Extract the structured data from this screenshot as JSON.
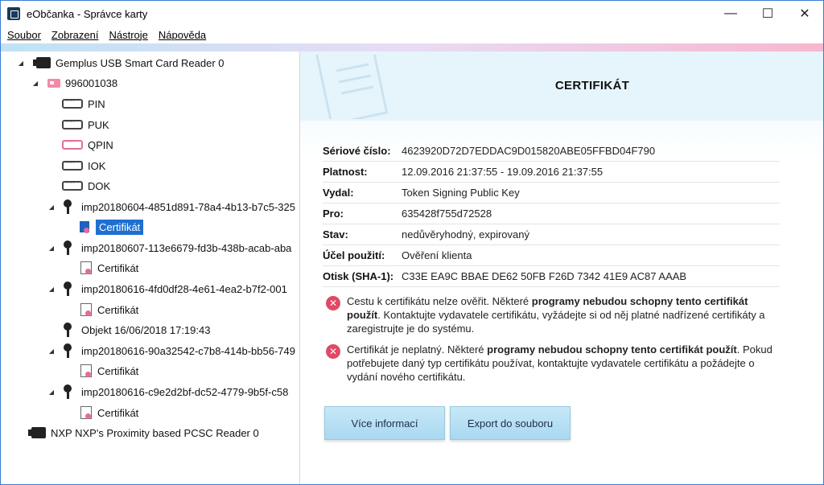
{
  "window": {
    "title": "eObčanka - Správce karty",
    "controls": {
      "minimize": "—",
      "maximize": "☐",
      "close": "✕"
    }
  },
  "menu": [
    "Soubor",
    "Zobrazení",
    "Nástroje",
    "Nápověda"
  ],
  "tree": {
    "reader1": "Gemplus USB Smart Card Reader 0",
    "card": "996001038",
    "pins": [
      "PIN",
      "PUK",
      "QPIN",
      "IOK",
      "DOK"
    ],
    "keys": [
      {
        "label": "imp20180604-4851d891-78a4-4b13-b7c5-325",
        "child": "Certifikát"
      },
      {
        "label": "imp20180607-113e6679-fd3b-438b-acab-aba",
        "child": "Certifikát"
      },
      {
        "label": "imp20180616-4fd0df28-4e61-4ea2-b7f2-001",
        "child": "Certifikát"
      },
      {
        "label": "Objekt 16/06/2018 17:19:43"
      },
      {
        "label": "imp20180616-90a32542-c7b8-414b-bb56-749",
        "child": "Certifikát"
      },
      {
        "label": "imp20180616-c9e2d2bf-dc52-4779-9b5f-c58",
        "child": "Certifikát"
      }
    ],
    "reader2": "NXP NXP's Proximity based PCSC Reader 0"
  },
  "detail": {
    "title": "CERTIFIKÁT",
    "props": [
      {
        "k": "Sériové číslo:",
        "v": "4623920D72D7EDDAC9D015820ABE05FFBD04F790"
      },
      {
        "k": "Platnost:",
        "v": "12.09.2016 21:37:55 - 19.09.2016 21:37:55"
      },
      {
        "k": "Vydal:",
        "v": "Token Signing Public Key"
      },
      {
        "k": "Pro:",
        "v": "635428f755d72528"
      },
      {
        "k": "Stav:",
        "v": "nedůvěryhodný, expirovaný"
      },
      {
        "k": "Účel použití:",
        "v": "Ověření klienta"
      },
      {
        "k": "Otisk (SHA-1):",
        "v": "C33E EA9C BBAE DE62 50FB F26D 7342 41E9 AC87 AAAB"
      }
    ],
    "warnings": [
      {
        "pre": "Cestu k certifikátu nelze ověřit. Některé ",
        "bold": "programy nebudou schopny tento certifikát použít",
        "post": ". Kontaktujte vydavatele certifikátu, vyžádejte si od něj platné nadřízené certifikáty a zaregistrujte je do systému."
      },
      {
        "pre": "Certifikát je neplatný. Některé ",
        "bold": "programy nebudou schopny tento certifikát použít",
        "post": ". Pokud potřebujete daný typ certifikátu používat, kontaktujte vydavatele certifikátu a požádejte o vydání nového certifikátu."
      }
    ],
    "buttons": {
      "more": "Více informací",
      "export": "Export do souboru"
    }
  }
}
